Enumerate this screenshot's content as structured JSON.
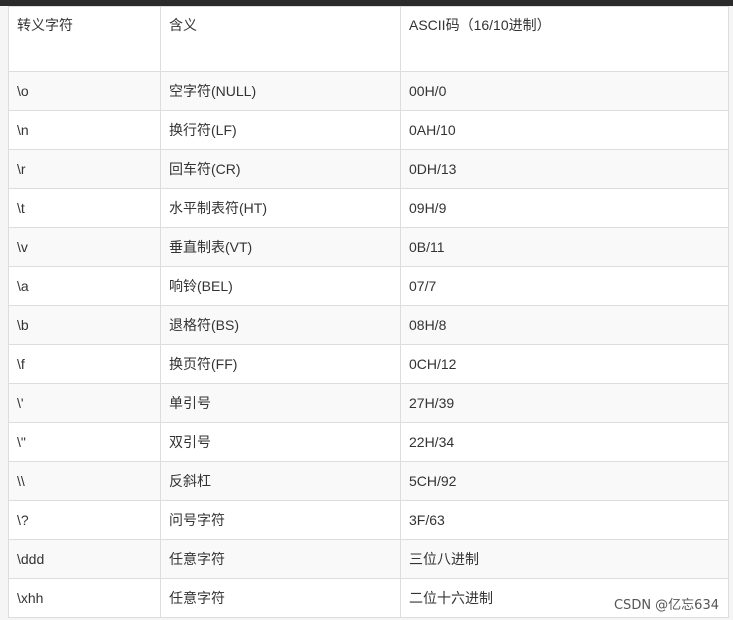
{
  "table": {
    "headers": [
      "转义字符",
      "含义",
      "ASCII码（16/10进制）"
    ],
    "rows": [
      [
        "\\o",
        "空字符(NULL)",
        "00H/0"
      ],
      [
        "\\n",
        "换行符(LF)",
        "0AH/10"
      ],
      [
        "\\r",
        "回车符(CR)",
        "0DH/13"
      ],
      [
        "\\t",
        "水平制表符(HT)",
        "09H/9"
      ],
      [
        "\\v",
        "垂直制表(VT)",
        "0B/11"
      ],
      [
        "\\a",
        "响铃(BEL)",
        "07/7"
      ],
      [
        "\\b",
        "退格符(BS)",
        "08H/8"
      ],
      [
        "\\f",
        "换页符(FF)",
        "0CH/12"
      ],
      [
        "\\'",
        "单引号",
        "27H/39"
      ],
      [
        "\\\"",
        "双引号",
        "22H/34"
      ],
      [
        "\\\\",
        "反斜杠",
        "5CH/92"
      ],
      [
        "\\?",
        "问号字符",
        "3F/63"
      ],
      [
        "\\ddd",
        "任意字符",
        "三位八进制"
      ],
      [
        "\\xhh",
        "任意字符",
        "二位十六进制"
      ]
    ]
  },
  "watermark": "CSDN @亿忘634"
}
